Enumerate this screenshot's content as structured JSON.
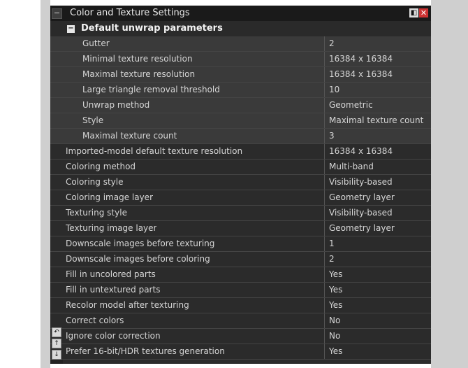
{
  "window": {
    "title": "Color and Texture Settings",
    "collapse_glyph": "−",
    "dock_glyph": "◧",
    "close_glyph": "✕"
  },
  "section": {
    "label": "Default unwrap parameters",
    "collapse_glyph": "−"
  },
  "sub_rows": [
    {
      "name": "Gutter",
      "value": "2"
    },
    {
      "name": "Minimal texture resolution",
      "value": "16384 x 16384"
    },
    {
      "name": "Maximal texture resolution",
      "value": "16384 x 16384"
    },
    {
      "name": "Large triangle removal threshold",
      "value": "10"
    },
    {
      "name": "Unwrap method",
      "value": "Geometric"
    },
    {
      "name": "Style",
      "value": "Maximal texture count"
    },
    {
      "name": "Maximal texture count",
      "value": "3"
    }
  ],
  "rows": [
    {
      "name": "Imported-model default texture resolution",
      "value": "16384 x 16384"
    },
    {
      "name": "Coloring method",
      "value": "Multi-band"
    },
    {
      "name": "Coloring style",
      "value": "Visibility-based"
    },
    {
      "name": "Coloring image layer",
      "value": "Geometry layer"
    },
    {
      "name": "Texturing style",
      "value": "Visibility-based"
    },
    {
      "name": "Texturing image layer",
      "value": "Geometry layer"
    },
    {
      "name": "Downscale images before texturing",
      "value": "1"
    },
    {
      "name": "Downscale images before coloring",
      "value": "2"
    },
    {
      "name": "Fill in uncolored parts",
      "value": "Yes"
    },
    {
      "name": "Fill in untextured parts",
      "value": "Yes"
    },
    {
      "name": "Recolor model after texturing",
      "value": "Yes"
    },
    {
      "name": "Correct colors",
      "value": "No"
    },
    {
      "name": "Ignore color correction",
      "value": "No"
    },
    {
      "name": "Prefer 16-bit/HDR textures generation",
      "value": "Yes"
    }
  ],
  "side_icons": [
    {
      "name": "undo-icon",
      "glyph": "↶"
    },
    {
      "name": "up-arrow-icon",
      "glyph": "↑"
    },
    {
      "name": "down-arrow-icon",
      "glyph": "↓"
    }
  ]
}
